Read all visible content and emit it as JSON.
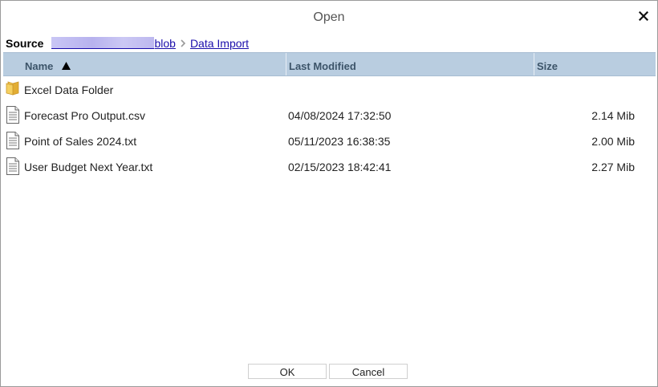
{
  "dialog": {
    "title": "Open"
  },
  "breadcrumb": {
    "source_label": "Source",
    "blob_label": "blob",
    "current_label": "Data Import"
  },
  "grid": {
    "columns": {
      "name": "Name",
      "modified": "Last Modified",
      "size": "Size"
    },
    "sort": {
      "column": "Name",
      "direction": "ascending",
      "icon": "sort-asc-icon"
    },
    "rows": [
      {
        "type": "folder",
        "icon": "folder-icon",
        "name": "Excel Data Folder",
        "modified": "",
        "size": ""
      },
      {
        "type": "file",
        "icon": "file-icon",
        "name": "Forecast Pro Output.csv",
        "modified": "04/08/2024 17:32:50",
        "size": "2.14 Mib"
      },
      {
        "type": "file",
        "icon": "file-icon",
        "name": "Point of Sales 2024.txt",
        "modified": "05/11/2023 16:38:35",
        "size": "2.00 Mib"
      },
      {
        "type": "file",
        "icon": "file-icon",
        "name": "User Budget Next Year.txt",
        "modified": "02/15/2023 18:42:41",
        "size": "2.27 Mib"
      }
    ]
  },
  "buttons": {
    "ok": "OK",
    "cancel": "Cancel"
  },
  "colors": {
    "header_bg": "#b9cde0",
    "header_text": "#3c5469",
    "link": "#1a0dab",
    "folder": "#e8b83a"
  }
}
